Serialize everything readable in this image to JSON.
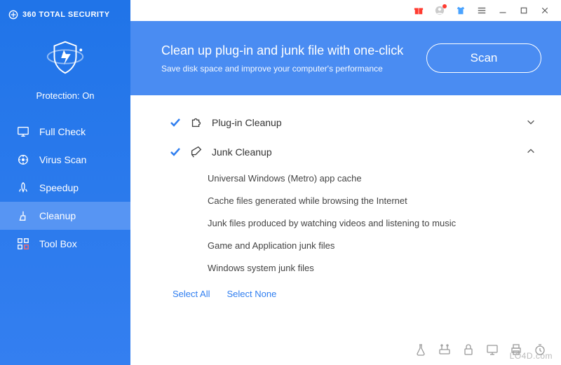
{
  "app": {
    "name": "360 TOTAL SECURITY",
    "protection_label": "Protection: On"
  },
  "sidebar": {
    "items": [
      {
        "label": "Full Check"
      },
      {
        "label": "Virus Scan"
      },
      {
        "label": "Speedup"
      },
      {
        "label": "Cleanup"
      },
      {
        "label": "Tool Box"
      }
    ],
    "active_index": 3
  },
  "banner": {
    "title": "Clean up plug-in and junk file with one-click",
    "subtitle": "Save disk space and improve your computer's performance",
    "scan_label": "Scan"
  },
  "sections": {
    "plugin": {
      "label": "Plug-in Cleanup",
      "checked": true,
      "expanded": false
    },
    "junk": {
      "label": "Junk Cleanup",
      "checked": true,
      "expanded": true,
      "items": [
        "Universal Windows (Metro) app cache",
        "Cache files generated while browsing the Internet",
        "Junk files produced by watching videos and listening to music",
        "Game and Application junk files",
        "Windows system junk files"
      ]
    }
  },
  "actions": {
    "select_all": "Select All",
    "select_none": "Select None"
  },
  "watermark": "LO4D.com",
  "colors": {
    "brand": "#3a82f0",
    "link": "#2f7ef0"
  }
}
